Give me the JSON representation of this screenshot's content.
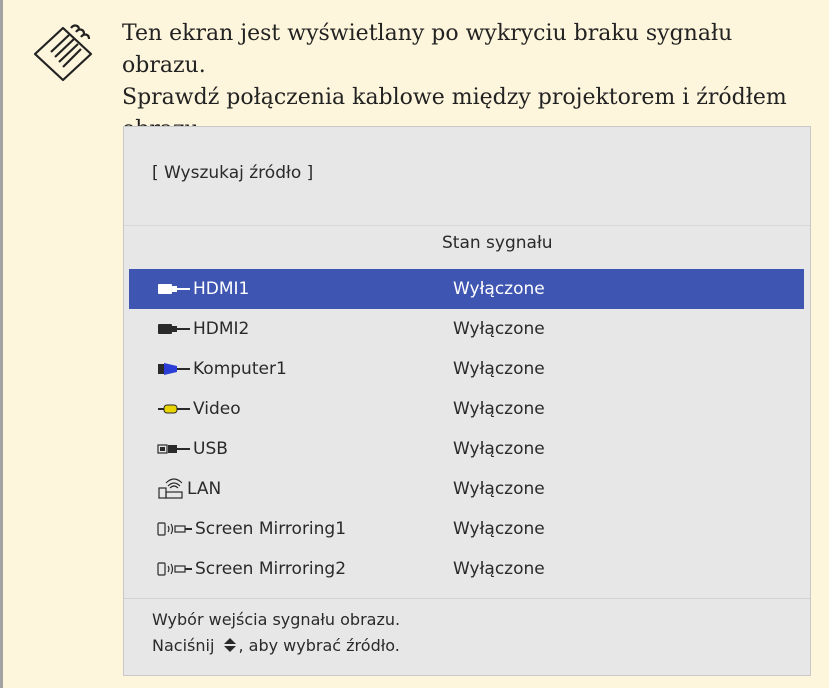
{
  "note": {
    "text_line1": "Ten ekran jest wyświetlany po wykryciu braku sygnału obrazu.",
    "text_line2": "Sprawdź połączenia kablowe między projektorem i źródłem",
    "text_line3": "obrazu.",
    "icon": "note-pad-icon"
  },
  "panel": {
    "title": "[ Wyszukaj źródło ]",
    "column_header": "Stan sygnału",
    "sources": [
      {
        "name": "HDMI1",
        "status": "Wyłączone",
        "icon": "hdmi-icon",
        "selected": true
      },
      {
        "name": "HDMI2",
        "status": "Wyłączone",
        "icon": "hdmi-icon",
        "selected": false
      },
      {
        "name": "Komputer1",
        "status": "Wyłączone",
        "icon": "vga-icon",
        "selected": false
      },
      {
        "name": "Video",
        "status": "Wyłączone",
        "icon": "rca-icon",
        "selected": false
      },
      {
        "name": "USB",
        "status": "Wyłączone",
        "icon": "usb-icon",
        "selected": false
      },
      {
        "name": "LAN",
        "status": "Wyłączone",
        "icon": "lan-wifi-icon",
        "selected": false
      },
      {
        "name": "Screen Mirroring1",
        "status": "Wyłączone",
        "icon": "screen-mirroring-icon",
        "selected": false
      },
      {
        "name": "Screen Mirroring2",
        "status": "Wyłączone",
        "icon": "screen-mirroring-icon",
        "selected": false
      }
    ],
    "help_line1": "Wybór wejścia sygnału obrazu.",
    "help_line2_before": "Naciśnij",
    "help_line2_after": ", aby wybrać źródło.",
    "help_icon": "up-down-arrows-icon",
    "selected_color": "#3f55b2"
  }
}
